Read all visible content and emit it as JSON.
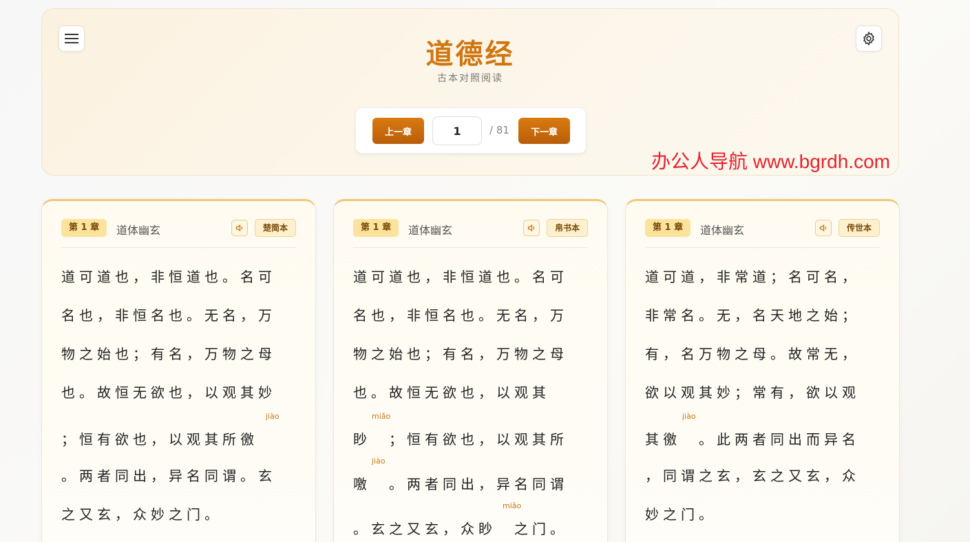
{
  "header": {
    "title": "道德经",
    "subtitle": "古本对照阅读",
    "prev_label": "上一章",
    "next_label": "下一章",
    "chapter_value": "1",
    "total": "/ 81"
  },
  "watermark": "办公人导航 www.bgrdh.com",
  "cards": [
    {
      "chapter": "第 1 章",
      "chapter_title": "道体幽玄",
      "version": "楚简本",
      "lines": [
        "道可道也，非恒道也。名可",
        "名也，非恒名也。无名，万",
        "物之始也；有名，万物之母",
        "也。故恒无欲也，以观其妙",
        "；恒有欲也，以观其所徼",
        "。两者同出，异名同谓。玄",
        "之又玄，众妙之门。"
      ],
      "pinyin": [
        "jiào"
      ]
    },
    {
      "chapter": "第 1 章",
      "chapter_title": "道体幽玄",
      "version": "帛书本",
      "lines": [
        "道可道也，非恒道也。名可",
        "名也，非恒名也。无名，万",
        "物之始也；有名，万物之母",
        "也。故恒无欲也，以观其",
        "眇　；恒有欲也，以观其所",
        "噭　。两者同出，异名同谓",
        "。玄之又玄，众眇　之门。"
      ],
      "pinyin": [
        "miǎo",
        "jiào",
        "miǎo"
      ]
    },
    {
      "chapter": "第 1 章",
      "chapter_title": "道体幽玄",
      "version": "传世本",
      "lines": [
        "道可道，非常道；名可名，",
        "非常名。无，名天地之始；",
        "有，名万物之母。故常无，",
        "欲以观其妙；常有，欲以观",
        "其徼　。此两者同出而异名",
        "，同谓之玄，玄之又玄，众",
        "妙之门。"
      ],
      "pinyin": [
        "jiào"
      ]
    }
  ]
}
